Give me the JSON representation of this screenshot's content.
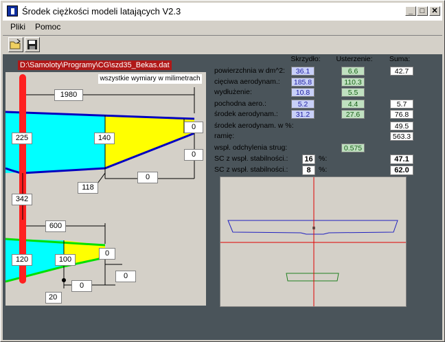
{
  "window": {
    "title": "Środek ciężkości modeli latających V2.3"
  },
  "menu": {
    "items": [
      "Pliki",
      "Pomoc"
    ]
  },
  "file_path": "D:\\Samoloty\\Programy\\CG\\szd35_Bekas.dat",
  "note": "wszystkie wymiary w milimetrach",
  "wing": {
    "span": "1980",
    "root_chord": "225",
    "mid_chord": "140",
    "tip_gap": "0",
    "sweep": "0",
    "mid_pos": "118",
    "mid_dist": "0",
    "distance": "342"
  },
  "tail": {
    "span": "600",
    "root_chord": "120",
    "mid_chord": "100",
    "tip_gap": "0",
    "sweep": "0",
    "mid_dist": "0",
    "mid_pos": "20"
  },
  "table": {
    "headers": [
      "Skrzydło:",
      "Usterzenie:",
      "Suma:"
    ],
    "rows": [
      {
        "label": "powierzchnia w dm^2:",
        "wing": "36.1",
        "tail": "6.6",
        "sum": "42.7"
      },
      {
        "label": "cięciwa aerodynam.:",
        "wing": "185.8",
        "tail": "110.3",
        "sum": ""
      },
      {
        "label": "wydłużenie:",
        "wing": "10.8",
        "tail": "5.5",
        "sum": ""
      },
      {
        "label": "pochodna aero.:",
        "wing": "5.2",
        "tail": "4.4",
        "sum": "5.7"
      },
      {
        "label": "środek aerodynam.:",
        "wing": "31.2",
        "tail": "27.6",
        "sum": "76.8"
      },
      {
        "label": "środek aerodynam. w %:",
        "wing": "",
        "tail": "",
        "sum": "49.5"
      },
      {
        "label": "ramię:",
        "wing": "",
        "tail": "",
        "sum": "563.3"
      },
      {
        "label": "wspł. odchylenia strug:",
        "wing": "",
        "tail": "0.575",
        "sum": ""
      }
    ],
    "sc1": {
      "label": "SC z wspł. stabilności.:",
      "input": "16",
      "unit": "%:",
      "value": "47.1"
    },
    "sc2": {
      "label": "SC z wspł. stabilności.:",
      "input": "8",
      "unit": "%:",
      "value": "62.0"
    }
  },
  "colors": {
    "wing_fill": "#00ffff",
    "wing_edge": "#0000c0",
    "tail_edge": "#00e000",
    "yellow": "#ffff00",
    "fuselage": "#ff0000"
  }
}
